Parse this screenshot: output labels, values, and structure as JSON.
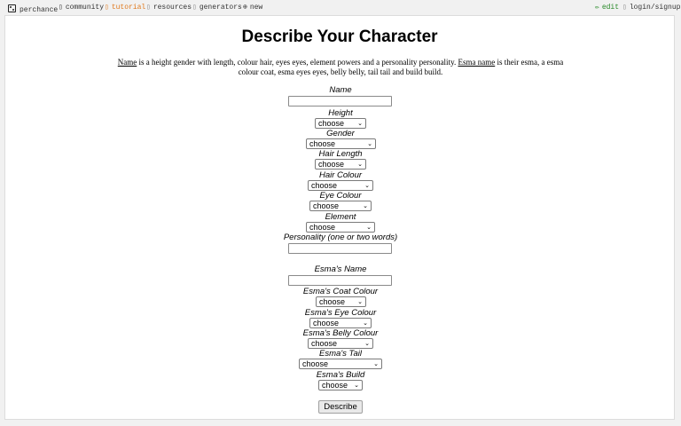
{
  "nav": {
    "items": [
      {
        "label": "perchance"
      },
      {
        "icon": "chat-icon",
        "label": "community"
      },
      {
        "icon": "book-icon",
        "label": "tutorial"
      },
      {
        "icon": "book-icon",
        "label": "resources"
      },
      {
        "icon": "grid-icon",
        "label": "generators"
      },
      {
        "icon": "plus-circle-icon",
        "label": "new"
      }
    ],
    "edit": {
      "icon": "pencil-icon",
      "label": "edit"
    },
    "login": {
      "icon": "user-icon",
      "label": "login/signup"
    }
  },
  "page": {
    "title": "Describe Your Character",
    "description": {
      "name_word": "Name",
      "part1": " is a height gender with length, colour hair, eyes eyes, element powers and a personality personality. ",
      "esma_word": "Esma name",
      "part2": " is their esma, a esma colour coat, esma eyes eyes, belly belly, tail tail and build build."
    }
  },
  "form": {
    "fields": [
      {
        "label": "Name",
        "type": "text",
        "value": ""
      },
      {
        "label": "Height",
        "type": "select",
        "value": "choose"
      },
      {
        "label": "Gender",
        "type": "select",
        "value": "choose"
      },
      {
        "label": "Hair Length",
        "type": "select",
        "value": "choose"
      },
      {
        "label": "Hair Colour",
        "type": "select",
        "value": "choose"
      },
      {
        "label": "Eye Colour",
        "type": "select",
        "value": "choose"
      },
      {
        "label": "Element",
        "type": "select",
        "value": "choose"
      },
      {
        "label": "Personality (one or two words)",
        "type": "text",
        "value": ""
      },
      {
        "label": "Esma's Name",
        "type": "text",
        "value": ""
      },
      {
        "label": "Esma's Coat Colour",
        "type": "select",
        "value": "choose"
      },
      {
        "label": "Esma's Eye Colour",
        "type": "select",
        "value": "choose"
      },
      {
        "label": "Esma's Belly Colour",
        "type": "select",
        "value": "choose"
      },
      {
        "label": "Esma's Tail",
        "type": "select",
        "value": "choose"
      },
      {
        "label": "Esma's Build",
        "type": "select",
        "value": "choose"
      }
    ],
    "submit_label": "Describe"
  }
}
